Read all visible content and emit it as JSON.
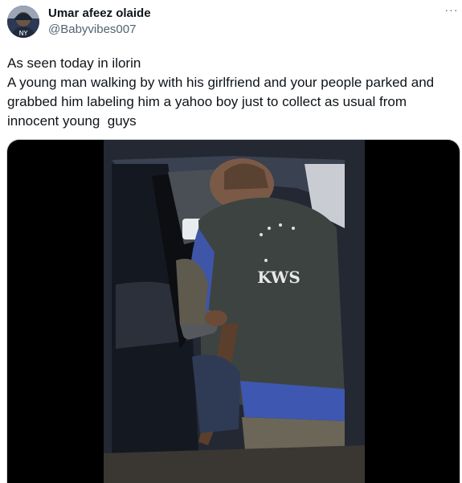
{
  "author": {
    "display_name": "Umar afeez olaide",
    "handle": "@Babyvibes007"
  },
  "menu": {
    "more_icon": "more-horizontal-icon",
    "more_glyph": "···"
  },
  "tweet": {
    "text": "As seen today in ilorin\nA young man walking by with his girlfriend and your people parked and grabbed him labeling him a yahoo boy just to collect as usual from innocent young  guys"
  },
  "media": {
    "vest_text": "KWS"
  },
  "colors": {
    "text_primary": "#0f1419",
    "text_secondary": "#536471",
    "media_background": "#000000"
  }
}
